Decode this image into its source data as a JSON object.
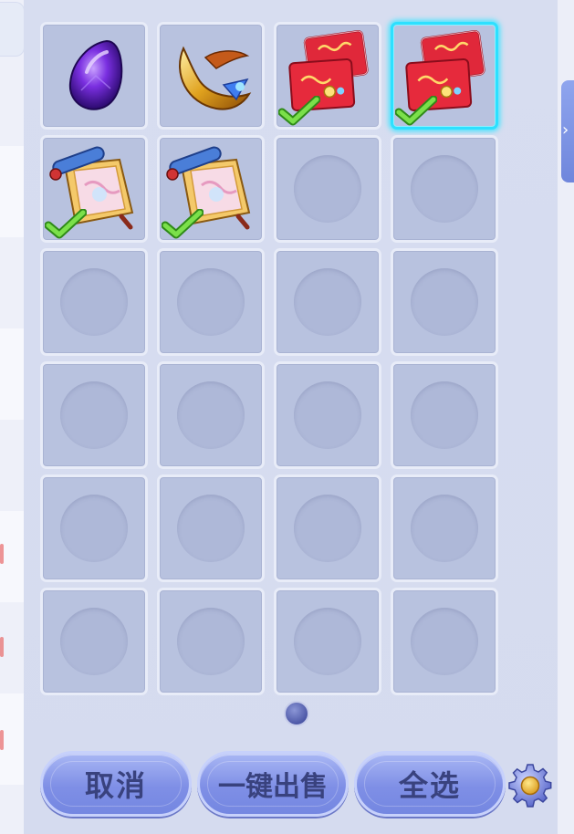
{
  "inventory": {
    "columns": 4,
    "rows": 6,
    "slots": [
      {
        "item": "purple-gem",
        "checked": false,
        "selected": false
      },
      {
        "item": "golden-horn",
        "checked": false,
        "selected": false
      },
      {
        "item": "red-envelopes",
        "checked": true,
        "selected": false
      },
      {
        "item": "red-envelopes",
        "checked": true,
        "selected": true
      },
      {
        "item": "scroll",
        "checked": true,
        "selected": false
      },
      {
        "item": "scroll",
        "checked": true,
        "selected": false
      },
      {
        "item": null
      },
      {
        "item": null
      },
      {
        "item": null
      },
      {
        "item": null
      },
      {
        "item": null
      },
      {
        "item": null
      },
      {
        "item": null
      },
      {
        "item": null
      },
      {
        "item": null
      },
      {
        "item": null
      },
      {
        "item": null
      },
      {
        "item": null
      },
      {
        "item": null
      },
      {
        "item": null
      },
      {
        "item": null
      },
      {
        "item": null
      },
      {
        "item": null
      },
      {
        "item": null
      }
    ],
    "selected_border_color": "#2de0ff",
    "check_color": "#5ad23a"
  },
  "pagination": {
    "current_page": 1,
    "total_pages": 1
  },
  "actions": {
    "cancel_label": "取消",
    "sell_label": "一键出售",
    "select_all_label": "全选"
  },
  "icons": {
    "settings": "gear-icon",
    "page_indicator": "page-dot-icon",
    "expand": "chevron-right-icon"
  }
}
